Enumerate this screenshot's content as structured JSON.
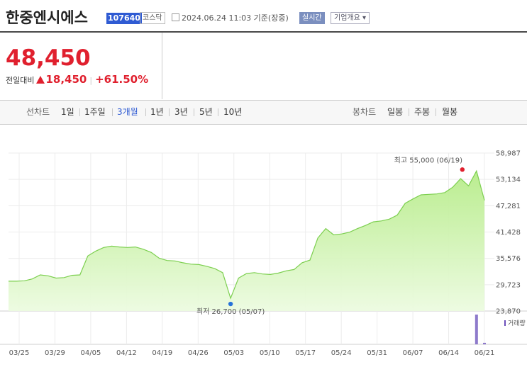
{
  "header": {
    "company_name": "한중엔시에스",
    "stock_code": "107640",
    "market": "코스닥",
    "date_info": "2024.06.24 11:03 기준(장중)",
    "realtime_label": "실시간",
    "company_overview_label": "기업개요 ▾"
  },
  "price": {
    "current": "48,450",
    "change_label": "전일대비",
    "change": "18,450",
    "change_pct": "+61.50%",
    "up_color": "#e0202e"
  },
  "tabs": {
    "line_chart_label": "선차트",
    "periods": [
      "1일",
      "1주일",
      "3개월",
      "1년",
      "3년",
      "5년",
      "10년"
    ],
    "active_period": "3개월",
    "candle_chart_label": "봉차트",
    "candles": [
      "일봉",
      "주봉",
      "월봉"
    ]
  },
  "chart_data": {
    "type": "area",
    "x_ticks": [
      "03/25",
      "03/29",
      "04/05",
      "04/12",
      "04/19",
      "04/26",
      "05/03",
      "05/10",
      "05/17",
      "05/24",
      "05/31",
      "06/07",
      "06/14",
      "06/21"
    ],
    "y_ticks": [
      "58,987",
      "53,134",
      "47,281",
      "41,428",
      "35,576",
      "29,723",
      "23,870"
    ],
    "ylim": [
      23870,
      58987
    ],
    "max_annotation": "최고 55,000 (06/19)",
    "min_annotation": "최저 26,700 (05/07)",
    "volume_legend": "거래량",
    "series_color": "#7ccf4f",
    "max_color": "#e0202e",
    "min_color": "#2672d9",
    "values": [
      30500,
      30500,
      30600,
      31000,
      31900,
      31700,
      31200,
      31300,
      31800,
      31900,
      36100,
      37200,
      38000,
      38300,
      38100,
      38000,
      38100,
      37600,
      36900,
      35600,
      35100,
      35000,
      34600,
      34300,
      34200,
      33800,
      33300,
      32400,
      26700,
      31200,
      32200,
      32400,
      32100,
      32000,
      32300,
      32800,
      33100,
      34600,
      35200,
      40100,
      42200,
      40800,
      41000,
      41400,
      42200,
      42900,
      43700,
      43900,
      44300,
      45200,
      47800,
      48800,
      49700,
      49800,
      49900,
      50200,
      51400,
      53300,
      51700,
      55000,
      48450
    ],
    "volume": [
      0.02,
      0.02,
      0.02,
      0.02,
      0.02,
      0.02,
      0.02,
      0.02,
      0.02,
      0.02,
      0.02,
      0.02,
      0.02,
      0.02,
      0.02,
      0.02,
      0.02,
      0.02,
      0.02,
      0.02,
      0.02,
      0.02,
      0.02,
      0.02,
      0.02,
      0.02,
      0.02,
      0.02,
      0.02,
      0.02,
      0.02,
      0.02,
      0.02,
      0.02,
      0.02,
      0.02,
      0.02,
      0.02,
      0.02,
      0.02,
      0.02,
      0.02,
      0.02,
      0.02,
      0.02,
      0.02,
      0.02,
      0.02,
      0.02,
      0.02,
      0.02,
      0.02,
      0.02,
      0.02,
      0.02,
      0.02,
      0.02,
      0.02,
      0.02,
      1.0,
      0.05
    ]
  }
}
